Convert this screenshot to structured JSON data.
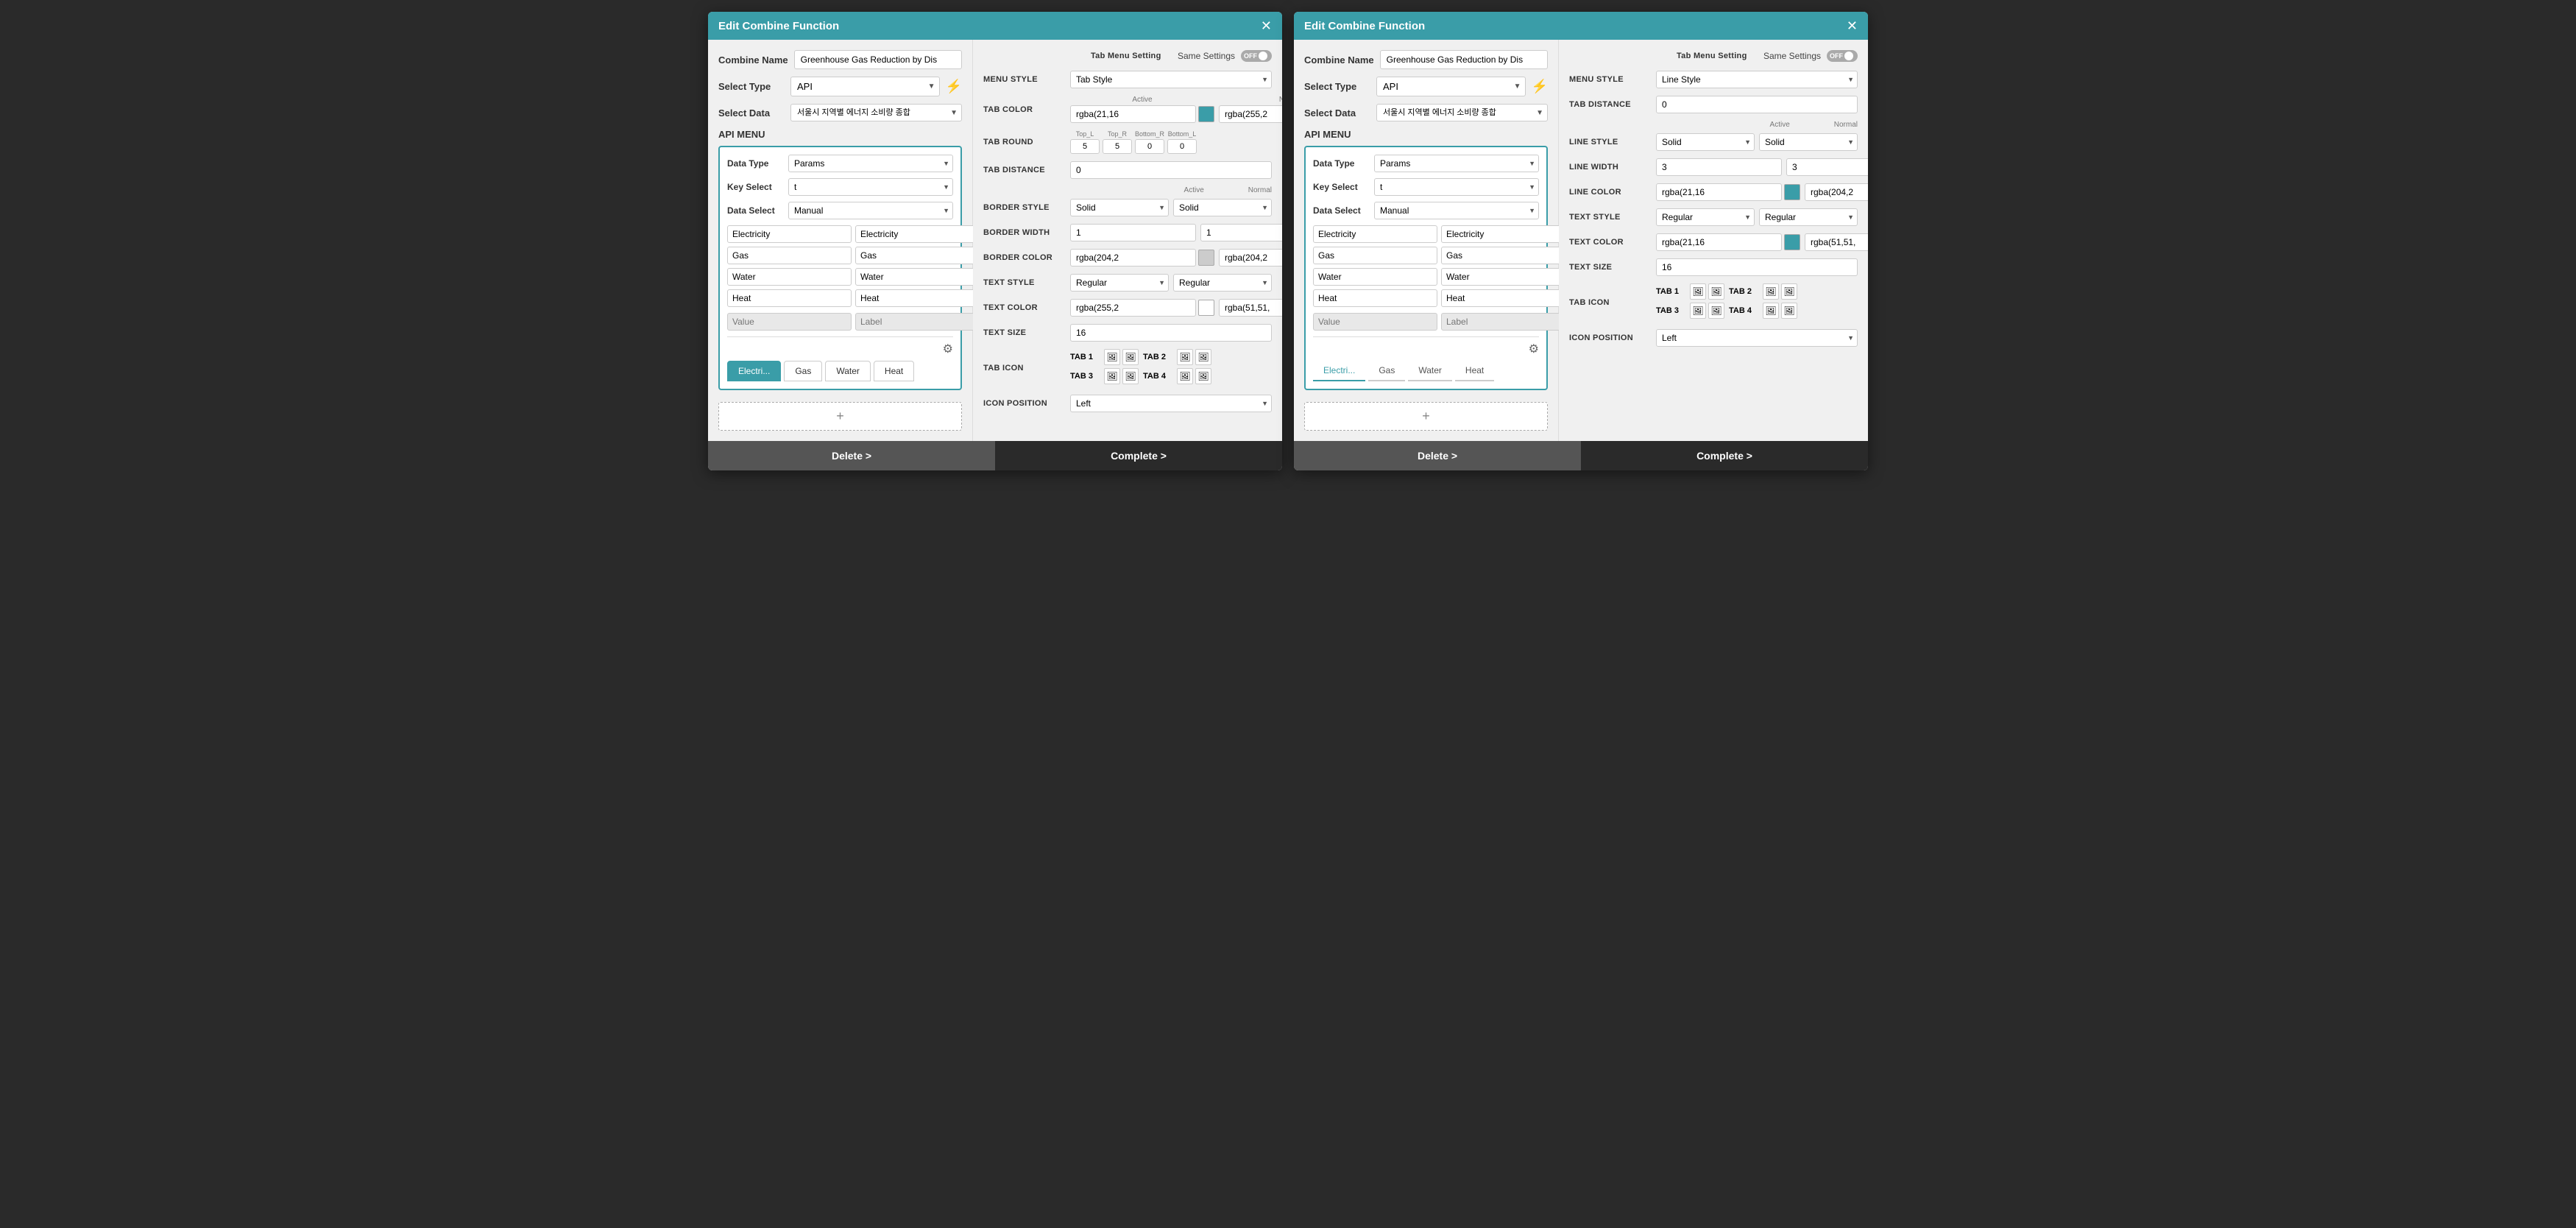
{
  "dialogs": [
    {
      "id": "dialog1",
      "header": "Edit Combine Function",
      "left": {
        "combine_name_label": "Combine Name",
        "combine_name_value": "Greenhouse Gas Reduction by Dis",
        "select_type_label": "Select Type",
        "select_type_value": "API",
        "select_data_label": "Select Data",
        "select_data_value": "서울시 지역별 에너지 소비량 종합",
        "api_menu_label": "API MENU",
        "data_type_label": "Data Type",
        "data_type_value": "Params",
        "key_select_label": "Key Select",
        "key_select_value": "t",
        "data_select_label": "Data Select",
        "data_select_value": "Manual",
        "items": [
          {
            "value": "Electricity",
            "label": "Electricity"
          },
          {
            "value": "Gas",
            "label": "Gas"
          },
          {
            "value": "Water",
            "label": "Water"
          },
          {
            "value": "Heat",
            "label": "Heat"
          }
        ],
        "value_placeholder": "Value",
        "label_placeholder": "Label",
        "tabs": [
          "Electri...",
          "Gas",
          "Water",
          "Heat"
        ],
        "active_tab": 0
      },
      "right": {
        "tab_menu_label": "Tab Menu Setting",
        "same_settings_label": "Same Settings",
        "toggle_state": "OFF",
        "menu_style_label": "MENU STYLE",
        "menu_style_value": "Tab Style",
        "tab_color_label": "TAB COLOR",
        "tab_color_active_label": "Active",
        "tab_color_normal_label": "Normal",
        "tab_color_active_value": "rgba(21,16",
        "tab_color_active_hex": "#3a9da8",
        "tab_color_normal_value": "rgba(255,2",
        "tab_color_normal_hex": "#ffffff",
        "tab_round_label": "TAB ROUND",
        "tab_round_tl": "5",
        "tab_round_tr": "5",
        "tab_round_br": "0",
        "tab_round_bl": "0",
        "tab_distance_label": "TAB DISTANCE",
        "tab_distance_value": "0",
        "border_style_label": "BORDER STYLE",
        "border_style_active": "Solid",
        "border_style_normal": "Solid",
        "border_width_label": "BORDER WIDTH",
        "border_width_active": "1",
        "border_width_normal": "1",
        "border_color_label": "BORDER COLOR",
        "border_color_active_value": "rgba(204,2",
        "border_color_active_hex": "#cccccc",
        "border_color_normal_value": "rgba(204,2",
        "border_color_normal_hex": "#cccccc",
        "text_style_label": "TEXT STYLE",
        "text_style_active": "Regular",
        "text_style_normal": "Regular",
        "text_color_label": "TEXT COLOR",
        "text_color_active_value": "rgba(255,2",
        "text_color_active_hex": "#ffffff",
        "text_color_normal_value": "rgba(51,51,",
        "text_color_normal_hex": "#333333",
        "text_size_label": "TEXT SIZE",
        "text_size_value": "16",
        "tab_icon_label": "TAB ICON",
        "icon_position_label": "ICON POSITION",
        "icon_position_value": "Left"
      }
    },
    {
      "id": "dialog2",
      "header": "Edit Combine Function",
      "left": {
        "combine_name_label": "Combine Name",
        "combine_name_value": "Greenhouse Gas Reduction by Dis",
        "select_type_label": "Select Type",
        "select_type_value": "API",
        "select_data_label": "Select Data",
        "select_data_value": "서울시 지역별 에너지 소비량 종합",
        "api_menu_label": "API MENU",
        "data_type_label": "Data Type",
        "data_type_value": "Params",
        "key_select_label": "Key Select",
        "key_select_value": "t",
        "data_select_label": "Data Select",
        "data_select_value": "Manual",
        "items": [
          {
            "value": "Electricity",
            "label": "Electricity"
          },
          {
            "value": "Gas",
            "label": "Gas"
          },
          {
            "value": "Water",
            "label": "Water"
          },
          {
            "value": "Heat",
            "label": "Heat"
          }
        ],
        "value_placeholder": "Value",
        "label_placeholder": "Label",
        "tabs": [
          "Electri...",
          "Gas",
          "Water",
          "Heat"
        ],
        "active_tab": 0
      },
      "right": {
        "tab_menu_label": "Tab Menu Setting",
        "same_settings_label": "Same Settings",
        "toggle_state": "OFF",
        "menu_style_label": "MENU STYLE",
        "menu_style_value": "Line Style",
        "tab_distance_label": "TAB DISTANCE",
        "tab_distance_value": "0",
        "line_style_label": "LINE STYLE",
        "line_style_active": "Solid",
        "line_style_normal": "Solid",
        "line_width_label": "LINE WIDTH",
        "line_width_active": "3",
        "line_width_normal": "3",
        "line_color_label": "LINE COLOR",
        "line_color_active_value": "rgba(21,16",
        "line_color_active_hex": "#3a9da8",
        "line_color_normal_value": "rgba(204,2",
        "line_color_normal_hex": "#cccccc",
        "text_style_label": "TEXT STYLE",
        "text_style_active": "Regular",
        "text_style_normal": "Regular",
        "text_color_label": "TEXT COLOR",
        "text_color_active_value": "rgba(21,16",
        "text_color_active_hex": "#3a9da8",
        "text_color_normal_value": "rgba(51,51,",
        "text_color_normal_hex": "#1a1a1a",
        "text_size_label": "TEXT SIZE",
        "text_size_value": "16",
        "tab_icon_label": "TAB ICON",
        "icon_position_label": "ICON POSITION",
        "icon_position_value": "Left"
      }
    }
  ],
  "buttons": {
    "delete": "Delete >",
    "complete": "Complete >",
    "add": "+"
  }
}
